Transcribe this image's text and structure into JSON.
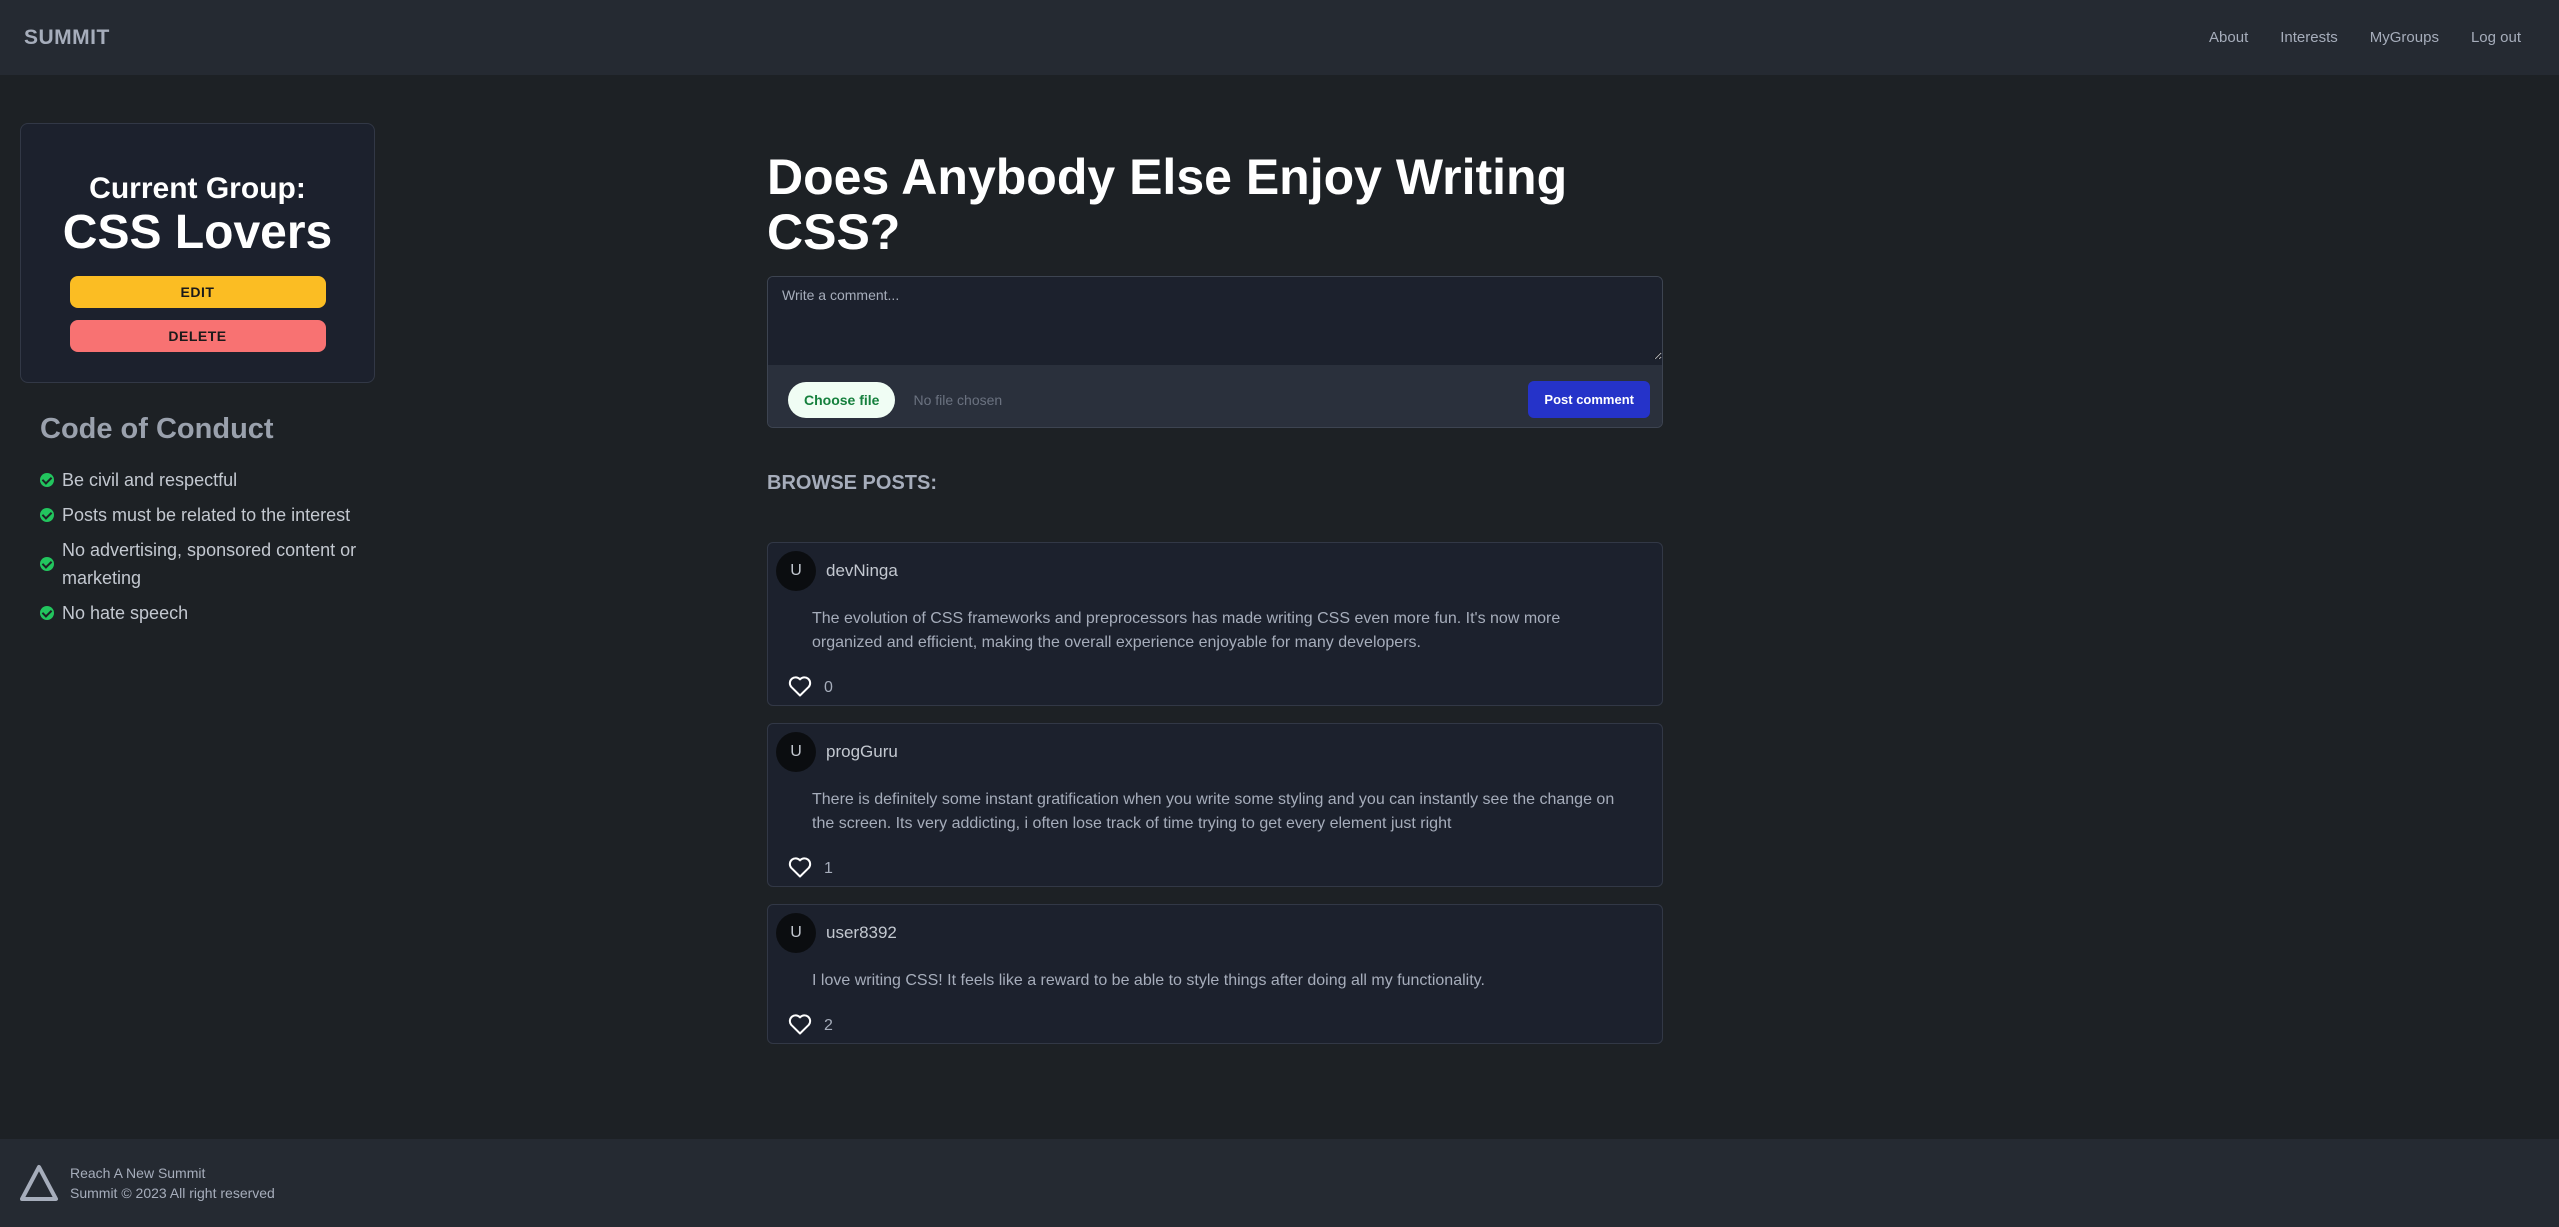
{
  "nav": {
    "brand": "SUMMIT",
    "links": [
      "About",
      "Interests",
      "MyGroups",
      "Log out"
    ]
  },
  "group": {
    "label": "Current Group:",
    "name": "CSS Lovers",
    "edit_label": "EDIT",
    "delete_label": "DELETE"
  },
  "conduct": {
    "title": "Code of Conduct",
    "rules": [
      "Be civil and respectful",
      "Posts must be related to the interest",
      "No advertising, sponsored content or marketing",
      "No hate speech"
    ]
  },
  "main": {
    "title": "Does Anybody Else Enjoy Writing CSS?",
    "comment_placeholder": "Write a comment...",
    "choose_file_label": "Choose file",
    "no_file_text": "No file chosen",
    "post_button_label": "Post comment",
    "browse_label": "BROWSE POSTS:"
  },
  "posts": [
    {
      "avatar": "U",
      "user": "devNinga",
      "text": "The evolution of CSS frameworks and preprocessors has made writing CSS even more fun. It's now more organized and efficient, making the overall experience enjoyable for many developers.",
      "likes": "0"
    },
    {
      "avatar": "U",
      "user": "progGuru",
      "text": "There is definitely some instant gratification when you write some styling and you can instantly see the change on the screen. Its very addicting, i often lose track of time trying to get every element just right",
      "likes": "1"
    },
    {
      "avatar": "U",
      "user": "user8392",
      "text": "I love writing CSS! It feels like a reward to be able to style things after doing all my functionality.",
      "likes": "2"
    }
  ],
  "footer": {
    "tagline": "Reach A New Summit",
    "copyright": "Summit © 2023 All right reserved",
    "logo_icon": "triangle-logo-icon"
  },
  "colors": {
    "background": "#1d2125",
    "navbar": "#252a32",
    "edit": "#fbbd23",
    "delete": "#f87272",
    "post_button": "#2533c9",
    "check": "#22c55e"
  }
}
